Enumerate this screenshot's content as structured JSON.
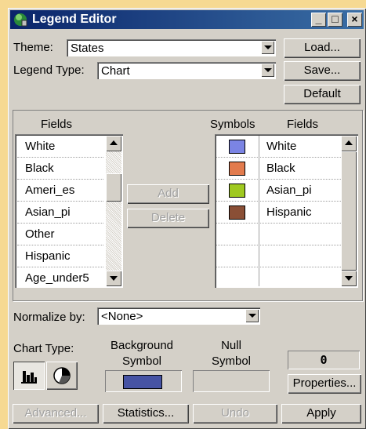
{
  "window": {
    "title": "Legend Editor"
  },
  "theme": {
    "label": "Theme:",
    "value": "States"
  },
  "legend_type": {
    "label": "Legend Type:",
    "value": "Chart"
  },
  "buttons": {
    "load": "Load...",
    "save": "Save...",
    "default": "Default",
    "add": "Add",
    "delete": "Delete",
    "properties": "Properties...",
    "advanced": "Advanced...",
    "statistics": "Statistics...",
    "undo": "Undo",
    "apply": "Apply"
  },
  "fields_panel": {
    "header": "Fields",
    "items": [
      "White",
      "Black",
      "Ameri_es",
      "Asian_pi",
      "Other",
      "Hispanic",
      "Age_under5"
    ]
  },
  "symbols_panel": {
    "symbols_header": "Symbols",
    "fields_header": "Fields",
    "items": [
      {
        "label": "White",
        "color": "#7b84e4"
      },
      {
        "label": "Black",
        "color": "#e27b4d"
      },
      {
        "label": "Asian_pi",
        "color": "#9fc920"
      },
      {
        "label": "Hispanic",
        "color": "#8a4f36"
      }
    ]
  },
  "normalize": {
    "label": "Normalize by:",
    "value": "<None>"
  },
  "chart_type": {
    "label": "Chart Type:"
  },
  "background_symbol": {
    "label_line1": "Background",
    "label_line2": "Symbol",
    "color": "#4653a4"
  },
  "null_symbol": {
    "label_line1": "Null",
    "label_line2": "Symbol"
  },
  "size_value": "0",
  "icons": [
    "legend-editor-app-icon",
    "minimize-icon",
    "maximize-icon",
    "close-icon",
    "bar-chart-icon",
    "pie-chart-icon"
  ]
}
